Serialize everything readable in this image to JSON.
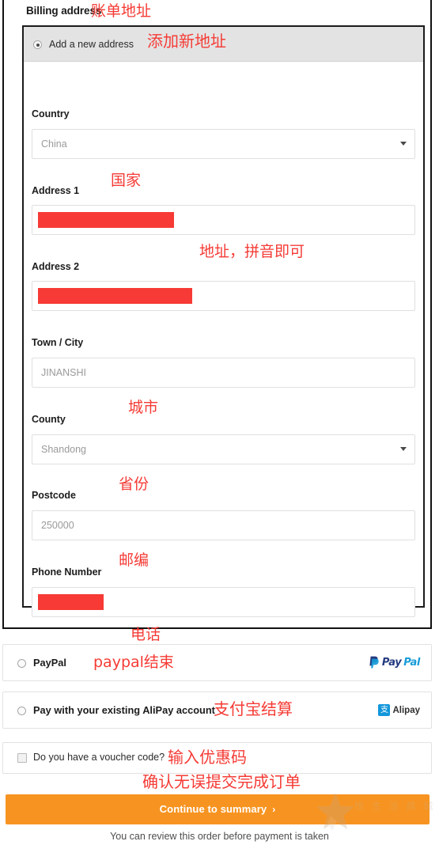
{
  "billing": {
    "heading": "Billing address",
    "heading_note_cn": "账单地址",
    "address_option": {
      "label": "Add a new address",
      "note_cn": "添加新地址",
      "selected": true
    },
    "fields": [
      {
        "key": "country",
        "label": "Country",
        "type": "select",
        "value": "China",
        "note_cn": "国家",
        "redacted": false
      },
      {
        "key": "address1",
        "label": "Address 1",
        "type": "text",
        "value": "",
        "note_cn": "地址，拼音即可",
        "redacted": true,
        "redact_width": 172
      },
      {
        "key": "address2",
        "label": "Address 2",
        "type": "text",
        "value": "",
        "note_cn": "",
        "redacted": true,
        "redact_width": 195
      },
      {
        "key": "town_city",
        "label": "Town / City",
        "type": "text",
        "value": "JINANSHI",
        "note_cn": "城市",
        "redacted": false
      },
      {
        "key": "county",
        "label": "County",
        "type": "select",
        "value": "Shandong",
        "note_cn": "省份",
        "redacted": false
      },
      {
        "key": "postcode",
        "label": "Postcode",
        "type": "text",
        "value": "250000",
        "note_cn": "邮编",
        "redacted": false
      },
      {
        "key": "phone",
        "label": "Phone Number",
        "type": "text",
        "value": "",
        "note_cn": "电话",
        "redacted": true,
        "redact_width": 83
      }
    ]
  },
  "payment": {
    "options": [
      {
        "key": "paypal",
        "label": "PayPal",
        "note_cn": "paypal结束",
        "selected": false,
        "logo": "paypal-logo",
        "logo_text_a": "Pay",
        "logo_text_b": "Pal"
      },
      {
        "key": "alipay",
        "label": "Pay with your existing AliPay account",
        "note_cn": "支付宝结算",
        "selected": false,
        "logo": "alipay-logo",
        "logo_text": "Alipay"
      }
    ]
  },
  "voucher": {
    "label": "Do you have a voucher code?",
    "note_cn": "输入优惠码",
    "checked": false
  },
  "cta": {
    "label": "Continue to summary",
    "chevron": "›",
    "note_cn": "确认无误提交完成订单",
    "review_note": "You can review this order before payment is taken",
    "color": "#f79421"
  },
  "watermark": {
    "text": "悦 生 活 商 城",
    "icon": "star-icon"
  },
  "colors": {
    "annotation_red": "#f53b35",
    "redaction_red": "#f73a35",
    "cta_orange": "#f79421",
    "panel_grey": "#e3e3e3"
  }
}
